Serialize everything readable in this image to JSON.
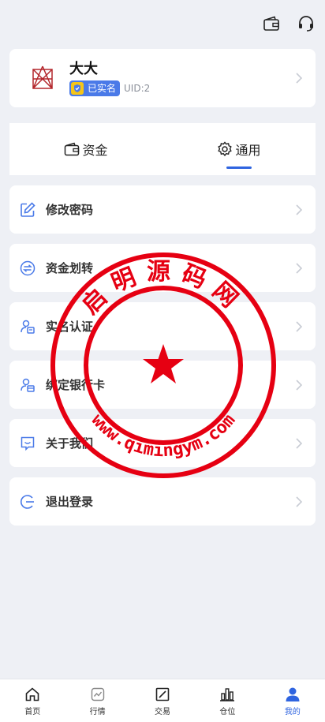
{
  "header": {
    "wallet_icon": "wallet-icon",
    "support_icon": "headset-icon"
  },
  "profile": {
    "nickname": "大大",
    "verified_label": "已实名",
    "uid": "UID:2",
    "avatar_icon": "geometric-logo-icon"
  },
  "tabs": [
    {
      "label": "资金",
      "icon": "wallet-icon",
      "active": false
    },
    {
      "label": "通用",
      "icon": "gear-icon",
      "active": true
    }
  ],
  "menu": [
    {
      "label": "修改密码",
      "icon": "edit-icon"
    },
    {
      "label": "资金划转",
      "icon": "transfer-icon"
    },
    {
      "label": "实名认证",
      "icon": "id-verify-icon"
    },
    {
      "label": "绑定银行卡",
      "icon": "bank-card-icon"
    },
    {
      "label": "关于我们",
      "icon": "chat-icon"
    },
    {
      "label": "退出登录",
      "icon": "logout-icon"
    }
  ],
  "watermark": {
    "top_text": "启明源码网",
    "bottom_text": "www.qimingym.com",
    "color": "#e60012"
  },
  "bottom_nav": [
    {
      "label": "首页",
      "icon": "home-icon",
      "active": false
    },
    {
      "label": "行情",
      "icon": "market-chart-icon",
      "active": false
    },
    {
      "label": "交易",
      "icon": "trade-icon",
      "active": false
    },
    {
      "label": "仓位",
      "icon": "position-bars-icon",
      "active": false
    },
    {
      "label": "我的",
      "icon": "user-icon",
      "active": true
    }
  ],
  "colors": {
    "accent": "#2f64e0",
    "badge": "#4a7ae8",
    "background": "#eef0f5"
  }
}
